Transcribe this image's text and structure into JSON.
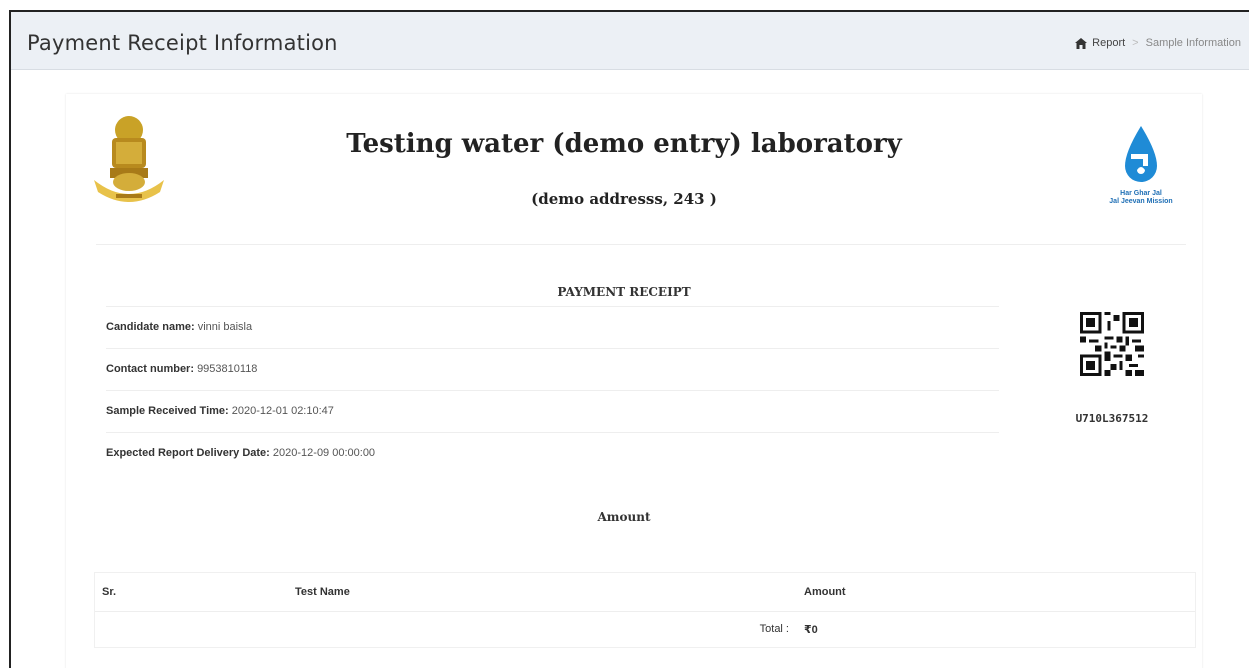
{
  "header": {
    "title": "Payment Receipt Information",
    "breadcrumb": {
      "home_icon": "home-icon",
      "link": "Report",
      "current": "Sample Information"
    }
  },
  "receipt": {
    "emblem_icon": "national-emblem-logo",
    "logo_icon": "har-ghar-jal-logo",
    "logo_text_line1": "Har Ghar Jal",
    "logo_text_line2": "Jal Jeevan Mission",
    "lab_name": "Testing water (demo entry) laboratory",
    "lab_address": "(demo addresss, 243 )",
    "title": "PAYMENT RECEIPT",
    "fields": {
      "candidate_label": "Candidate name:",
      "candidate_value": "vinni baisla",
      "contact_label": "Contact number:",
      "contact_value": "9953810118",
      "received_label": "Sample Received Time:",
      "received_value": "2020-12-01 02:10:47",
      "delivery_label": "Expected Report Delivery Date:",
      "delivery_value": "2020-12-09 00:00:00"
    },
    "qr_icon": "qr-code",
    "sample_code": "U710L367512",
    "amount_title": "Amount",
    "table": {
      "headers": [
        "Sr.",
        "Test Name",
        "Amount"
      ],
      "total_label": "Total :",
      "total_value": "₹0"
    }
  },
  "colors": {
    "header_bg": "#ecf0f5",
    "logo_blue": "#1f6fb5",
    "emblem_gold": "#c9a227"
  }
}
